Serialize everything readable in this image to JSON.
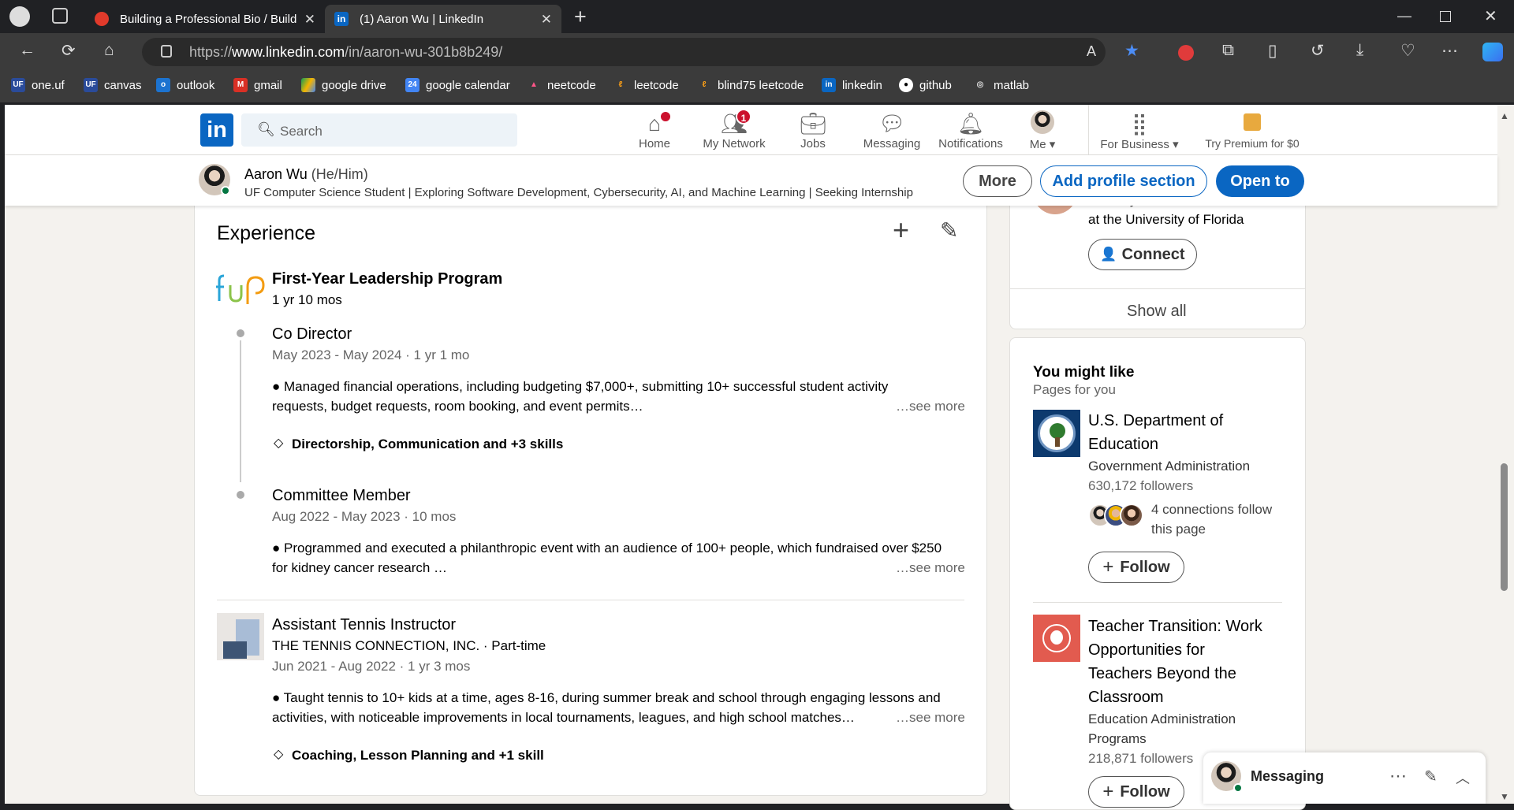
{
  "browser": {
    "tabs": [
      {
        "title": "Building a Professional Bio / Build"
      },
      {
        "title": "(1) Aaron Wu | LinkedIn"
      }
    ],
    "url_prefix": "https://",
    "url_domain": "www.linkedin.com",
    "url_path": "/in/aaron-wu-301b8b249/",
    "bookmarks": [
      "one.uf",
      "canvas",
      "outlook",
      "gmail",
      "google drive",
      "google calendar",
      "neetcode",
      "leetcode",
      "blind75 leetcode",
      "linkedin",
      "github",
      "matlab"
    ]
  },
  "linkedin": {
    "search_placeholder": "Search",
    "nav": [
      {
        "label": "Home",
        "badge": ""
      },
      {
        "label": "My Network",
        "badge": "1"
      },
      {
        "label": "Jobs",
        "badge": ""
      },
      {
        "label": "Messaging",
        "badge": ""
      },
      {
        "label": "Notifications",
        "badge": ""
      },
      {
        "label": "Me",
        "badge": ""
      },
      {
        "label": "For Business",
        "badge": ""
      },
      {
        "label": "Try Premium for $0",
        "badge": ""
      }
    ],
    "profile": {
      "name": "Aaron Wu",
      "pronouns": "(He/Him)",
      "headline": "UF Computer Science Student | Exploring Software Development, Cybersecurity, AI, and Machine Learning | Seeking Internship",
      "more": "More",
      "add_section": "Add profile section",
      "open_to": "Open to"
    },
    "experience": {
      "title": "Experience",
      "org1": {
        "name": "First-Year Leadership Program",
        "duration": "1 yr 10 mos",
        "roles": [
          {
            "title": "Co Director",
            "dates": "May 2023 - May 2024 · 1 yr 1 mo",
            "desc1": "● Managed financial operations, including budgeting $7,000+, submitting 10+ successful student activity",
            "desc2": "requests, budget requests, room booking, and event permits…",
            "see_more": "…see more",
            "skills": "Directorship, Communication and +3 skills"
          },
          {
            "title": "Committee Member",
            "dates": "Aug 2022 - May 2023 · 10 mos",
            "desc1": "● Programmed and executed a philanthropic event with an audience of 100+ people, which fundraised over $250",
            "desc2": "for kidney cancer research …",
            "see_more": "…see more"
          }
        ]
      },
      "org2": {
        "title": "Assistant Tennis Instructor",
        "company": "THE TENNIS CONNECTION, INC. · Part-time",
        "dates": "Jun 2021 - Aug 2022 · 1 yr 3 mos",
        "desc1": "● Taught tennis to 10+ kids at a time, ages 8-16, during summer break and school through engaging lessons and",
        "desc2": "activities, with noticeable improvements in local tournaments, leagues, and high school matches…",
        "see_more": "…see more",
        "skills": "Coaching, Lesson Planning and +1 skill"
      }
    },
    "sidebar": {
      "partial_line1": "Pre-Physician Assistant Student",
      "partial_line2": "at the University of Florida",
      "connect": "Connect",
      "show_all": "Show all",
      "might_like_title": "You might like",
      "might_like_sub": "Pages for you",
      "page1": {
        "name1": "U.S. Department of",
        "name2": "Education",
        "type": "Government Administration",
        "followers": "630,172 followers",
        "conn1": "4 connections follow",
        "conn2": "this page",
        "follow": "Follow"
      },
      "page2": {
        "name1": "Teacher Transition: Work",
        "name2": "Opportunities for",
        "name3": "Teachers Beyond the",
        "name4": "Classroom",
        "type1": "Education Administration",
        "type2": "Programs",
        "followers": "218,871 followers",
        "follow": "Follow"
      }
    },
    "messaging": {
      "label": "Messaging"
    }
  }
}
